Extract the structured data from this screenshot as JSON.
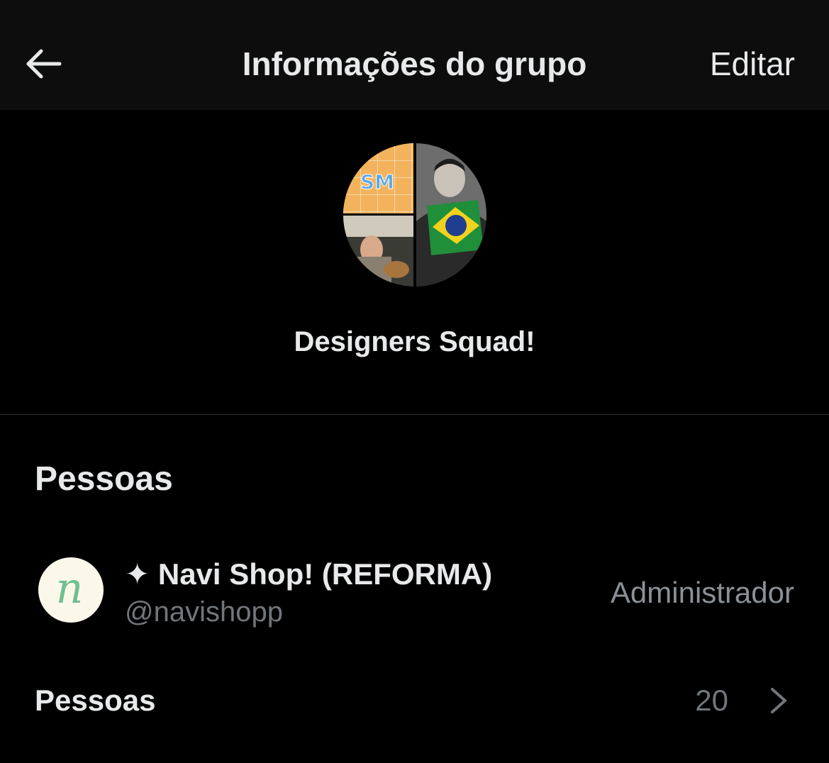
{
  "header": {
    "title": "Informações do grupo",
    "edit_label": "Editar",
    "back_icon": "arrow-left-icon"
  },
  "group": {
    "name": "Designers Squad!",
    "avatar_badge": "SM"
  },
  "people_section": {
    "heading": "Pessoas",
    "members": [
      {
        "name": "✦ Navi Shop! (REFORMA)",
        "handle": "@navishopp",
        "role": "Administrador",
        "avatar_letter": "n"
      }
    ]
  },
  "people_row": {
    "label": "Pessoas",
    "count": "20",
    "chevron_icon": "chevron-right-icon"
  },
  "colors": {
    "background": "#000000",
    "header_background": "#0d0d0d",
    "primary_text": "#e7e9ea",
    "secondary_text": "#71767b",
    "divider": "#2f3336",
    "avatar_accent": "#6fbf8f"
  }
}
